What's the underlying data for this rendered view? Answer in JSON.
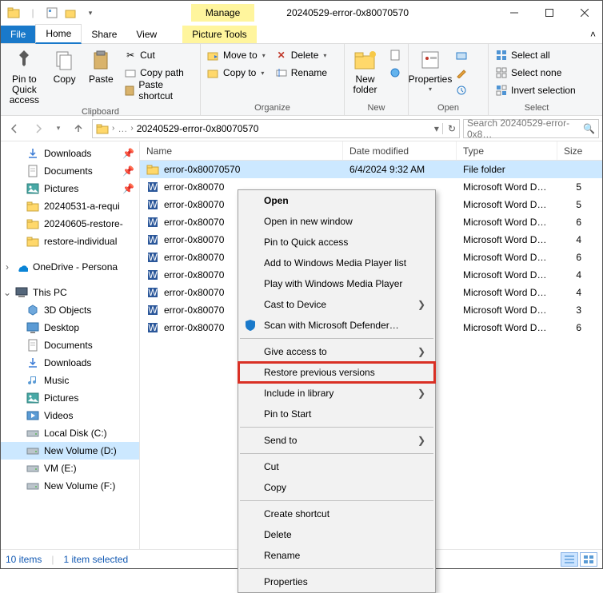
{
  "window": {
    "title": "20240529-error-0x80070570",
    "contextual_tab": "Manage",
    "picture_tools": "Picture Tools"
  },
  "tabs": {
    "file": "File",
    "home": "Home",
    "share": "Share",
    "view": "View",
    "picture_tools": "Picture Tools"
  },
  "ribbon": {
    "pin_to_quick_access": "Pin to Quick access",
    "copy": "Copy",
    "paste": "Paste",
    "cut": "Cut",
    "copy_path": "Copy path",
    "paste_shortcut": "Paste shortcut",
    "clipboard_group": "Clipboard",
    "move_to": "Move to",
    "copy_to": "Copy to",
    "delete": "Delete",
    "rename": "Rename",
    "organize_group": "Organize",
    "new_folder": "New folder",
    "new_group": "New",
    "properties": "Properties",
    "open_group": "Open",
    "select_all": "Select all",
    "select_none": "Select none",
    "invert_selection": "Invert selection",
    "select_group": "Select"
  },
  "address": {
    "current": "20240529-error-0x80070570",
    "search_placeholder": "Search 20240529-error-0x8…"
  },
  "navpane": {
    "quick": [
      {
        "label": "Downloads",
        "icon": "download",
        "pinned": true
      },
      {
        "label": "Documents",
        "icon": "document",
        "pinned": true
      },
      {
        "label": "Pictures",
        "icon": "pictures",
        "pinned": true
      },
      {
        "label": "20240531-a-requi",
        "icon": "folder"
      },
      {
        "label": "20240605-restore-",
        "icon": "folder"
      },
      {
        "label": "restore-individual",
        "icon": "folder"
      }
    ],
    "onedrive": "OneDrive - Persona",
    "thispc": "This PC",
    "thispc_items": [
      {
        "label": "3D Objects",
        "icon": "3d"
      },
      {
        "label": "Desktop",
        "icon": "desktop"
      },
      {
        "label": "Documents",
        "icon": "document"
      },
      {
        "label": "Downloads",
        "icon": "download"
      },
      {
        "label": "Music",
        "icon": "music"
      },
      {
        "label": "Pictures",
        "icon": "pictures"
      },
      {
        "label": "Videos",
        "icon": "videos"
      },
      {
        "label": "Local Disk (C:)",
        "icon": "drive"
      },
      {
        "label": "New Volume (D:)",
        "icon": "drive",
        "selected": true
      },
      {
        "label": "VM (E:)",
        "icon": "drive"
      },
      {
        "label": "New Volume (F:)",
        "icon": "drive"
      }
    ]
  },
  "columns": {
    "name": "Name",
    "date": "Date modified",
    "type": "Type",
    "size": "Size"
  },
  "files": [
    {
      "name": "error-0x80070570",
      "date": "6/4/2024 9:32 AM",
      "type": "File folder",
      "size": "",
      "icon": "folder",
      "selected": true
    },
    {
      "name": "error-0x80070",
      "date": "",
      "type": "Microsoft Word D…",
      "size": "5",
      "icon": "word"
    },
    {
      "name": "error-0x80070",
      "date": "",
      "type": "Microsoft Word D…",
      "size": "5",
      "icon": "word"
    },
    {
      "name": "error-0x80070",
      "date": "",
      "type": "Microsoft Word D…",
      "size": "6",
      "icon": "word"
    },
    {
      "name": "error-0x80070",
      "date": "",
      "type": "Microsoft Word D…",
      "size": "4",
      "icon": "word"
    },
    {
      "name": "error-0x80070",
      "date": "",
      "type": "Microsoft Word D…",
      "size": "6",
      "icon": "word"
    },
    {
      "name": "error-0x80070",
      "date": "",
      "type": "Microsoft Word D…",
      "size": "4",
      "icon": "word"
    },
    {
      "name": "error-0x80070",
      "date": "",
      "type": "Microsoft Word D…",
      "size": "4",
      "icon": "word"
    },
    {
      "name": "error-0x80070",
      "date": "",
      "type": "Microsoft Word D…",
      "size": "3",
      "icon": "word"
    },
    {
      "name": "error-0x80070",
      "date": "",
      "type": "Microsoft Word D…",
      "size": "6",
      "icon": "word"
    }
  ],
  "context_menu": [
    {
      "label": "Open",
      "bold": true
    },
    {
      "label": "Open in new window"
    },
    {
      "label": "Pin to Quick access"
    },
    {
      "label": "Add to Windows Media Player list"
    },
    {
      "label": "Play with Windows Media Player"
    },
    {
      "label": "Cast to Device",
      "submenu": true
    },
    {
      "label": "Scan with Microsoft Defender…",
      "icon": "shield"
    },
    {
      "sep": true
    },
    {
      "label": "Give access to",
      "submenu": true
    },
    {
      "label": "Restore previous versions",
      "highlight": true
    },
    {
      "label": "Include in library",
      "submenu": true
    },
    {
      "label": "Pin to Start"
    },
    {
      "sep": true
    },
    {
      "label": "Send to",
      "submenu": true
    },
    {
      "sep": true
    },
    {
      "label": "Cut"
    },
    {
      "label": "Copy"
    },
    {
      "sep": true
    },
    {
      "label": "Create shortcut"
    },
    {
      "label": "Delete"
    },
    {
      "label": "Rename"
    },
    {
      "sep": true
    },
    {
      "label": "Properties"
    }
  ],
  "status": {
    "items": "10 items",
    "selected": "1 item selected"
  }
}
